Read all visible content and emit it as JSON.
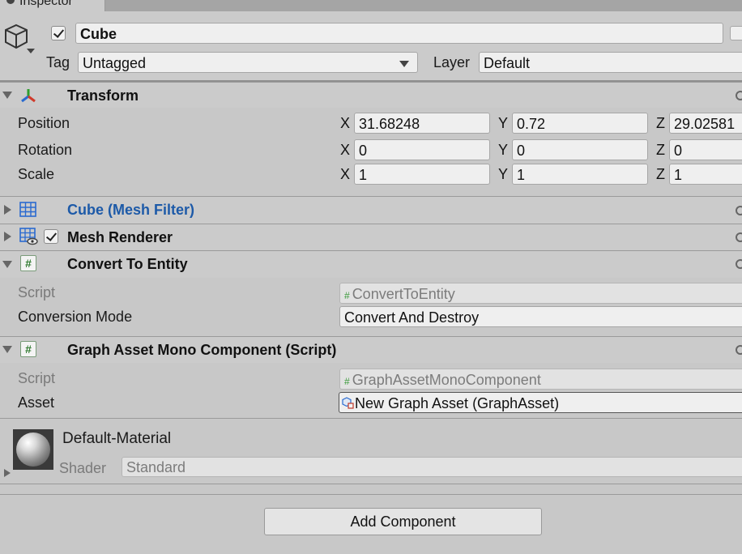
{
  "tab": {
    "label": "Inspector"
  },
  "gameobject": {
    "name": "Cube",
    "active": true,
    "tag_label": "Tag",
    "tag_value": "Untagged",
    "layer_label": "Layer",
    "layer_value": "Default"
  },
  "transform": {
    "title": "Transform",
    "position": {
      "label": "Position",
      "x": "31.68248",
      "y": "0.72",
      "z": "29.02581"
    },
    "rotation": {
      "label": "Rotation",
      "x": "0",
      "y": "0",
      "z": "0"
    },
    "scale": {
      "label": "Scale",
      "x": "1",
      "y": "1",
      "z": "1"
    },
    "axis_x": "X",
    "axis_y": "Y",
    "axis_z": "Z"
  },
  "mesh_filter": {
    "title": "Cube (Mesh Filter)"
  },
  "mesh_renderer": {
    "title": "Mesh Renderer",
    "enabled": true
  },
  "convert_to_entity": {
    "title": "Convert To Entity",
    "script_label": "Script",
    "script_value": "ConvertToEntity",
    "mode_label": "Conversion Mode",
    "mode_value": "Convert And Destroy"
  },
  "graph_asset": {
    "title": "Graph Asset Mono Component (Script)",
    "script_label": "Script",
    "script_value": "GraphAssetMonoComponent",
    "asset_label": "Asset",
    "asset_value": "New Graph Asset (GraphAsset)"
  },
  "material": {
    "name": "Default-Material",
    "shader_label": "Shader",
    "shader_value": "Standard"
  },
  "add_component_label": "Add Component",
  "colors": {
    "link_blue": "#1d5aa8",
    "hash_green": "#2f7a2f"
  }
}
